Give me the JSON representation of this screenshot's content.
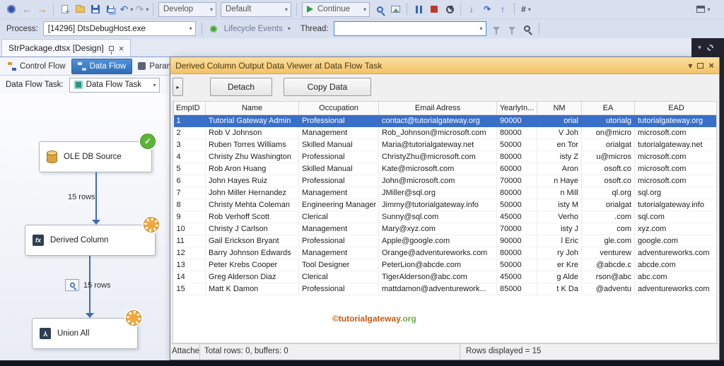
{
  "window": {
    "toolbar1": {
      "develop": "Develop",
      "default": "Default",
      "continue_label": "Continue"
    },
    "toolbar2": {
      "process_label": "Process:",
      "process_value": "[14296] DtsDebugHost.exe",
      "lifecycle_label": "Lifecycle Events",
      "thread_label": "Thread:",
      "thread_value": ""
    },
    "document_tab": "StrPackage.dtsx [Design]",
    "designer_tabs": [
      "Control Flow",
      "Data Flow",
      "Paramete"
    ],
    "task_label": "Data Flow Task:",
    "task_value": "Data Flow Task"
  },
  "canvas": {
    "nodes": [
      {
        "label": "OLE DB Source",
        "status": "success"
      },
      {
        "label": "Derived Column",
        "status": "running"
      },
      {
        "label": "Union All",
        "status": "running"
      }
    ],
    "edge1_label": "15 rows",
    "edge2_label": "15 rows"
  },
  "dialog": {
    "title": "Derived Column Output Data Viewer at Data Flow Task",
    "detach_label": "Detach",
    "copy_label": "Copy Data",
    "watermark_main": "©tutorialgateway",
    "watermark_suffix": ".org",
    "status_left": "Attache",
    "status_mid": "Total rows: 0, buffers: 0",
    "status_right": "Rows displayed = 15",
    "grid": {
      "columns": [
        "EmpID",
        "Name",
        "Occupation",
        "Email Adress",
        "YearlyIn...",
        "NM",
        "EA",
        "EAD"
      ],
      "selected_row": 0,
      "rows": [
        [
          "1",
          "Tutorial Gateway Admin",
          "Professional",
          "contact@tutorialgateway.org",
          "90000",
          "orial",
          "utorialg",
          "tutorialgateway.org"
        ],
        [
          "2",
          "Rob V Johnson",
          "Management",
          "Rob_Johnson@microsoft.com",
          "80000",
          "V Joh",
          "on@micro",
          "microsoft.com"
        ],
        [
          "3",
          "Ruben Torres Williams",
          "Skilled Manual",
          "Maria@tutorialgateway.net",
          "50000",
          "en Tor",
          "orialgat",
          "tutorialgateway.net"
        ],
        [
          "4",
          "Christy Zhu Washington",
          "Professional",
          "ChristyZhu@microsoft.com",
          "80000",
          "isty Z",
          "u@micros",
          "microsoft.com"
        ],
        [
          "5",
          "Rob Aron Huang",
          "Skilled Manual",
          "Kate@microsoft.com",
          "60000",
          "Aron",
          "osoft.co",
          "microsoft.com"
        ],
        [
          "6",
          "John Hayes Ruiz",
          "Professional",
          "John@microsoft.com",
          "70000",
          "n Haye",
          "osoft.co",
          "microsoft.com"
        ],
        [
          "7",
          "John Miller Hernandez",
          "Management",
          "JMiller@sql.org",
          "80000",
          "n Mill",
          "ql.org",
          "sql.org"
        ],
        [
          "8",
          "Christy Mehta Coleman",
          "Engineering Manager",
          "Jimmy@tutorialgateway.info",
          "50000",
          "isty M",
          "orialgat",
          "tutorialgateway.info"
        ],
        [
          "9",
          "Rob Verhoff  Scott",
          "Clerical",
          "Sunny@sql.com",
          "45000",
          "Verho",
          ".com",
          "sql.com"
        ],
        [
          "10",
          "Christy J Carlson",
          "Management",
          "Mary@xyz.com",
          "70000",
          "isty J",
          "com",
          "xyz.com"
        ],
        [
          "11",
          "Gail Erickson Bryant",
          "Professional",
          "Apple@google.com",
          "90000",
          "l Eric",
          "gle.com",
          "google.com"
        ],
        [
          "12",
          "Barry Johnson Edwards",
          "Management",
          "Orange@adventureworks.com",
          "80000",
          "ry Joh",
          "venturew",
          "adventureworks.com"
        ],
        [
          "13",
          "Peter Krebs Cooper",
          "Tool Designer",
          "PeterLion@abcde.com",
          "50000",
          "er Kre",
          "@abcde.c",
          "abcde.com"
        ],
        [
          "14",
          "Greg Alderson Diaz",
          "Clerical",
          "TigerAlderson@abc.com",
          "45000",
          "g Alde",
          "rson@abc",
          "abc.com"
        ],
        [
          "15",
          "Matt K Damon",
          "Professional",
          "mattdamon@adventurework...",
          "85000",
          "t K Da",
          "@adventu",
          "adventureworks.com"
        ]
      ]
    }
  },
  "icons": {
    "chevron_down": "▾",
    "back_arrow": "←",
    "forward_arrow": "→",
    "undo_arrow": "↶",
    "redo_arrow": "↷",
    "check": "✓",
    "close": "×",
    "collapse_arrow": "▸",
    "step_into": "↓",
    "step_over": "↷",
    "step_out": "↑",
    "hex_toggle": "#"
  }
}
